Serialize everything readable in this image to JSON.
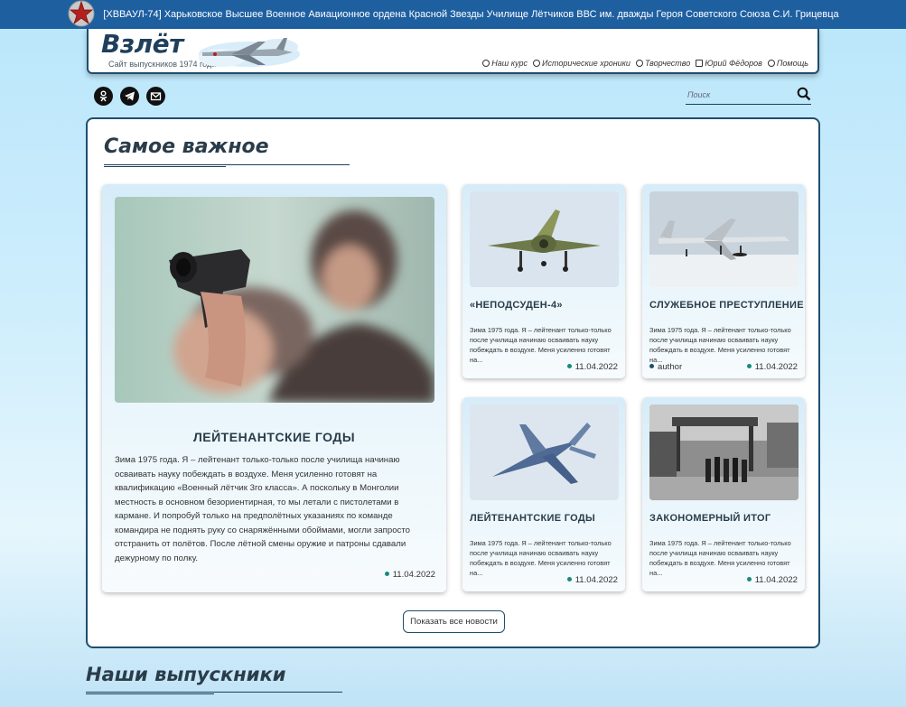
{
  "banner": {
    "title": "[ХВВАУЛ-74] Харьковское Высшее Военное Авиационное ордена Красной Звезды Училище Лётчиков ВВС им. дважды Героя Советского Союза С.И. Грицевца",
    "emblem_icon": "red-star-icon"
  },
  "header": {
    "logo": "Взлёт",
    "subtitle": "Сайт выпускников 1974 года",
    "nav": [
      {
        "label": "Наш курс",
        "icon": "circle-icon"
      },
      {
        "label": "Исторические хроники",
        "icon": "chat-icon"
      },
      {
        "label": "Творчество",
        "icon": "brush-icon"
      },
      {
        "label": "Юрий Фёдоров",
        "icon": "doc-icon"
      },
      {
        "label": "Помощь",
        "icon": "help-icon"
      }
    ]
  },
  "social": [
    "odnoklassniki-icon",
    "telegram-icon",
    "email-icon"
  ],
  "search": {
    "placeholder": "Поиск"
  },
  "main": {
    "section_title": "Самое важное",
    "featured": {
      "title": "ЛЕЙТЕНАНТСКИЕ ГОДЫ",
      "text": "Зима 1975 года. Я – лейтенант только-только после училища начинаю осваивать науку побеждать в воздухе. Меня усиленно готовят на квалификацию «Военный лётчик 3го класса». А поскольку в Монголии местность в основном безориентирная, то мы летали с пистолетами в кармане. И попробуй только на предполётных указаниях по команде командира не поднять руку со снаряжёнными обоймами, могли запросто отстранить от полётов. После лётной смены оружие и патроны сдавали дежурному по полку.",
      "date": "11.04.2022"
    },
    "cards": [
      {
        "title": "«НЕПОДСУДЕН-4»",
        "text": "Зима 1975 года. Я – лейтенант только-только после училища начинаю осваивать науку побеждать в воздухе. Меня усиленно готовят на...",
        "date": "11.04.2022",
        "author": ""
      },
      {
        "title": "СЛУЖЕБНОЕ ПРЕСТУПЛЕНИЕ",
        "text": "Зима 1975 года. Я – лейтенант только-только после училища начинаю осваивать науку побеждать в воздухе. Меня усиленно готовят на...",
        "date": "11.04.2022",
        "author": "author"
      },
      {
        "title": "ЛЕЙТЕНАНТСКИЕ ГОДЫ",
        "text": "Зима 1975 года. Я – лейтенант только-только после училища начинаю осваивать науку побеждать в воздухе. Меня усиленно готовят на...",
        "date": "11.04.2022",
        "author": ""
      },
      {
        "title": "ЗАКОНОМЕРНЫЙ ИТОГ",
        "text": "Зима 1975 года. Я – лейтенант только-только после училища начинаю осваивать науку побеждать в воздухе. Меня усиленно готовят на...",
        "date": "11.04.2022",
        "author": ""
      }
    ],
    "show_all": "Показать все новости"
  },
  "graduates": {
    "title": "Наши выпускники"
  }
}
